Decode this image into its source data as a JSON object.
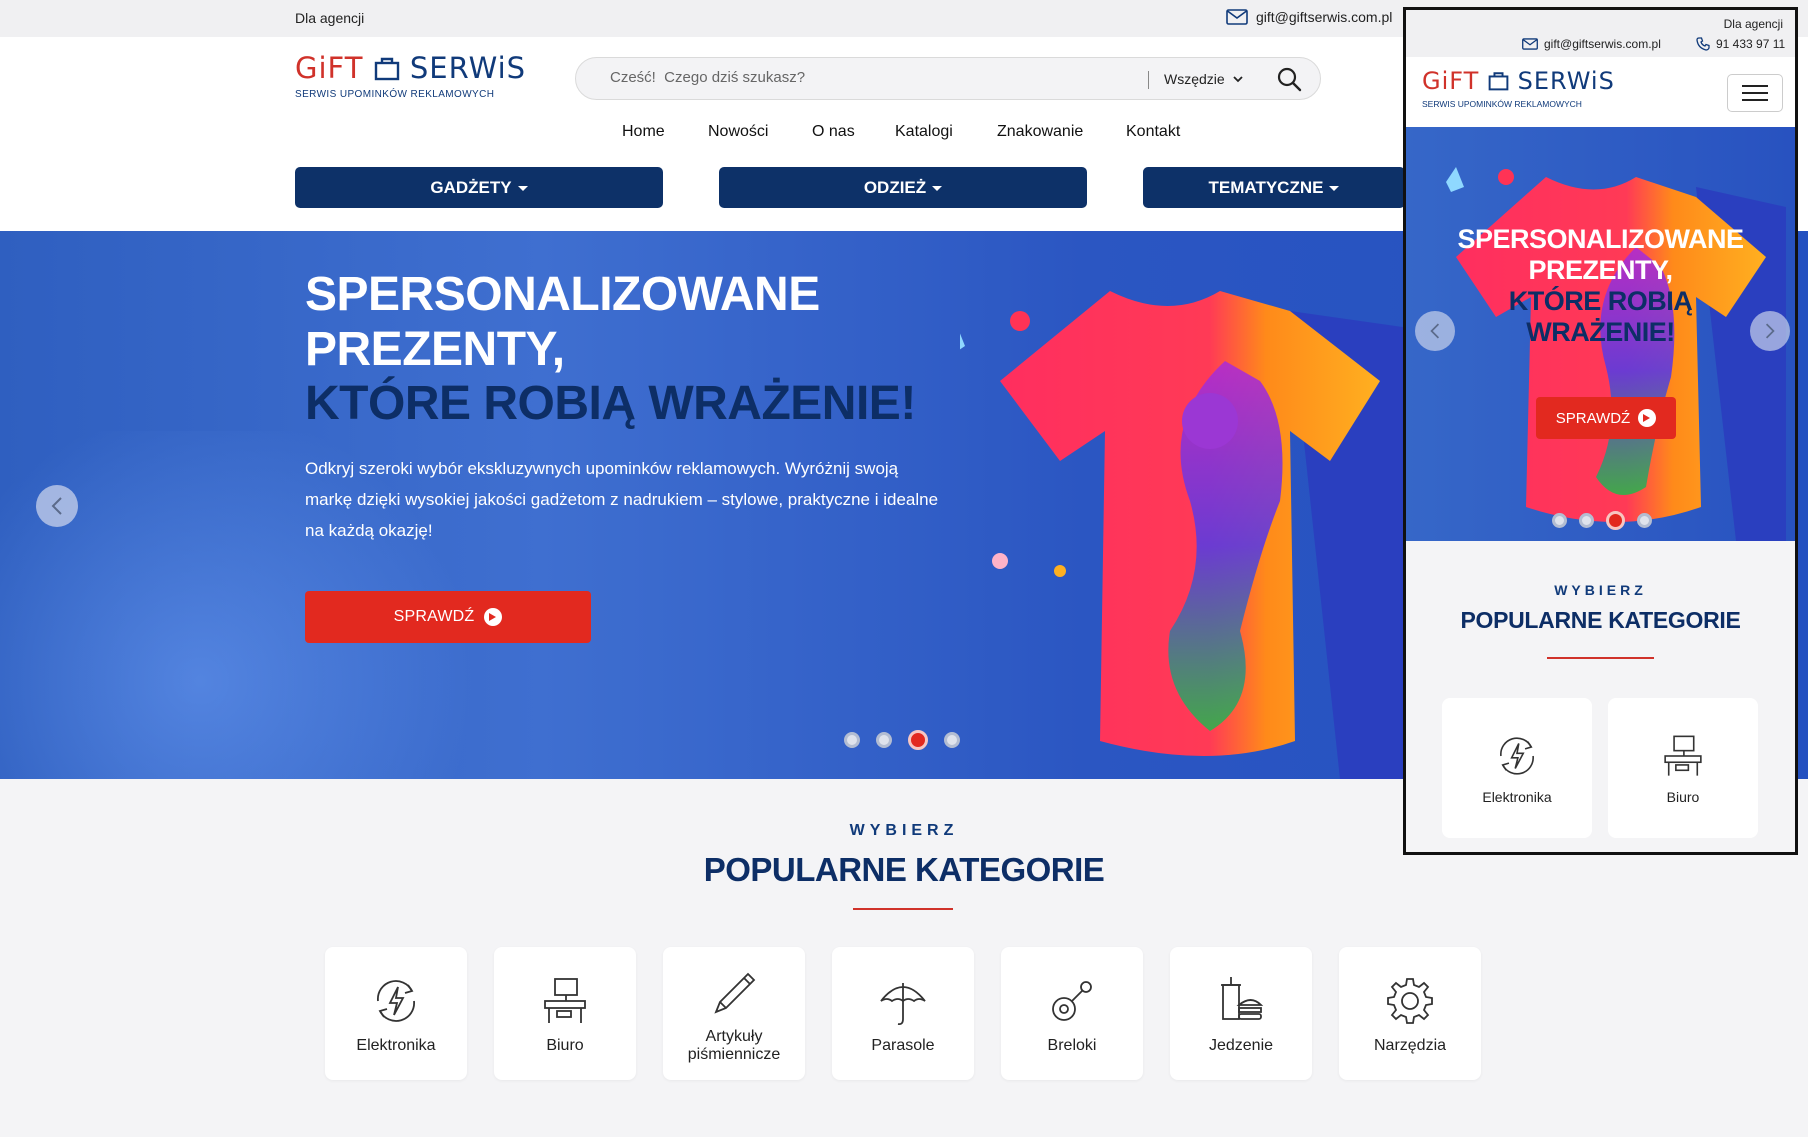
{
  "topbar": {
    "agencies": "Dla agencji",
    "email": "gift@giftserwis.com.pl"
  },
  "logo": {
    "brand_gift": "GiFT",
    "brand_serwis": "SERWiS",
    "tagline": "Serwis upominków reklamowych"
  },
  "search": {
    "placeholder": "Cześć!  Czego dziś szukasz?",
    "scope": "Wszędzie"
  },
  "nav": {
    "items": [
      "Home",
      "Nowości",
      "O nas",
      "Katalogi",
      "Znakowanie",
      "Kontakt"
    ]
  },
  "categories_menu": [
    "GADŻETY",
    "ODZIEŻ",
    "TEMATYCZNE"
  ],
  "hero": {
    "title_line1": "SPERSONALIZOWANE",
    "title_line2": "PREZENTY,",
    "title_line3": "KTÓRE ROBIĄ WRAŻENIE!",
    "description": "Odkryj szeroki wybór ekskluzywnych upominków reklamowych. Wyróżnij swoją markę dzięki wysokiej jakości gadżetom z nadrukiem – stylowe, praktyczne i idealne na każdą okazję!",
    "cta": "SPRAWDŹ",
    "slides_count": 4,
    "active_slide": 3
  },
  "popular": {
    "eyebrow": "WYBIERZ",
    "title": "POPULARNE KATEGORIE",
    "items": [
      {
        "label": "Elektronika",
        "icon": "lightning-refresh-icon"
      },
      {
        "label": "Biuro",
        "icon": "office-desk-icon"
      },
      {
        "label": "Artykuły piśmiennicze",
        "icon": "pen-icon"
      },
      {
        "label": "Parasole",
        "icon": "umbrella-icon"
      },
      {
        "label": "Breloki",
        "icon": "keychain-icon"
      },
      {
        "label": "Jedzenie",
        "icon": "food-icon"
      },
      {
        "label": "Narzędzia",
        "icon": "gear-icon"
      }
    ]
  },
  "mobile": {
    "agencies": "Dla agencji",
    "email": "gift@giftserwis.com.pl",
    "phone": "91 433 97 11",
    "hero_line1": "SPERSONALIZOWANE",
    "hero_line2": "PREZENTY,",
    "hero_line3": "KTÓRE ROBIĄ",
    "hero_line4": "WRAŻENIE!",
    "cta": "SPRAWDŹ",
    "eyebrow": "WYBIERZ",
    "title": "POPULARNE KATEGORIE",
    "cards": [
      "Elektronika",
      "Biuro"
    ]
  },
  "colors": {
    "navy": "#0d3168",
    "red": "#e2291f",
    "hero_blue": "#3f6fd0"
  }
}
